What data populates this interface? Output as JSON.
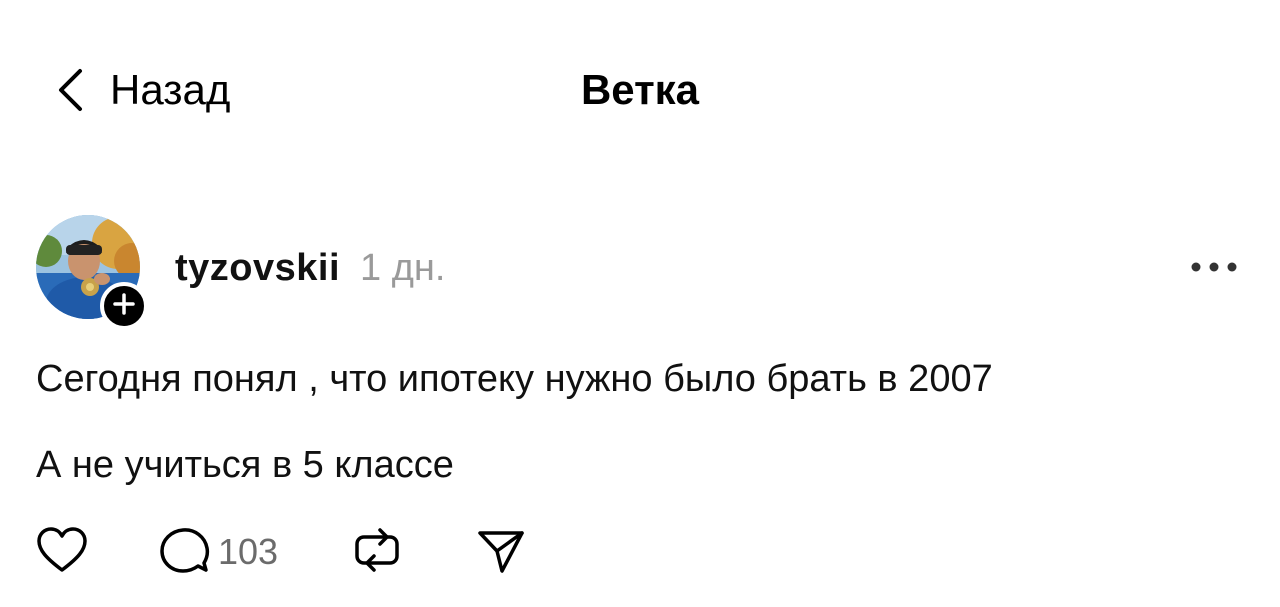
{
  "header": {
    "back_label": "Назад",
    "title": "Ветка"
  },
  "post": {
    "username": "tyzovskii",
    "time": "1 дн.",
    "text_lines": [
      "Сегодня понял , что ипотеку нужно было брать в 2007",
      "А не учиться в 5 классе"
    ],
    "reply_count": "103"
  },
  "icons": {
    "back": "chevron-left-icon",
    "follow": "plus-icon",
    "more": "more-dots-icon",
    "like": "heart-icon",
    "reply": "comment-icon",
    "repost": "repost-icon",
    "share": "send-icon"
  },
  "colors": {
    "text": "#111111",
    "muted": "#9a9a9a",
    "icon": "#000000"
  }
}
